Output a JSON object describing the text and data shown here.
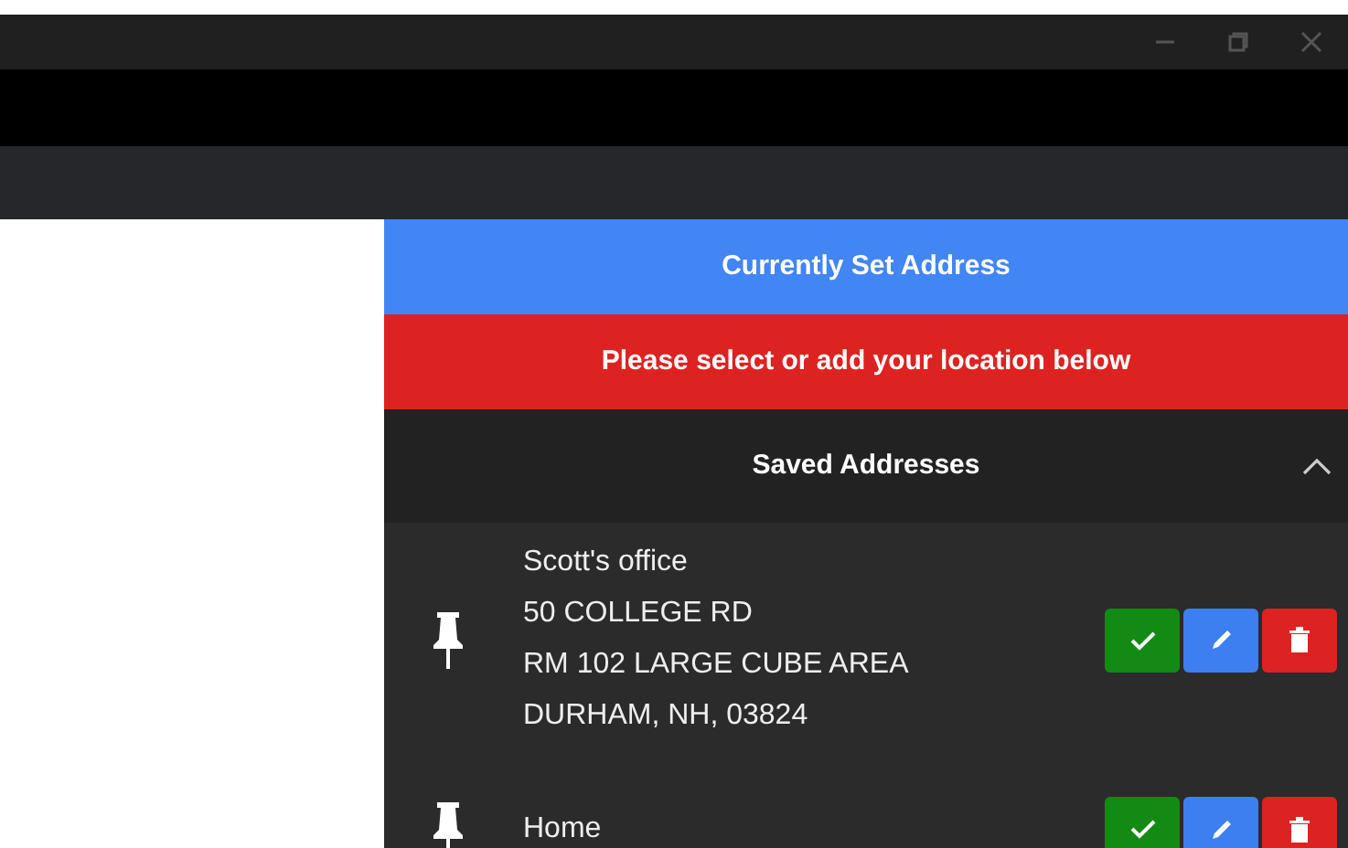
{
  "current_address_header": "Currently Set Address",
  "warning": "Please select or add your location below",
  "saved_addresses": {
    "title": "Saved Addresses",
    "expanded": true,
    "items": [
      {
        "name": "Scott's office",
        "lines": [
          "50 COLLEGE RD",
          "RM 102 LARGE CUBE AREA",
          "DURHAM, NH, 03824"
        ]
      },
      {
        "name": "Home"
      }
    ]
  }
}
